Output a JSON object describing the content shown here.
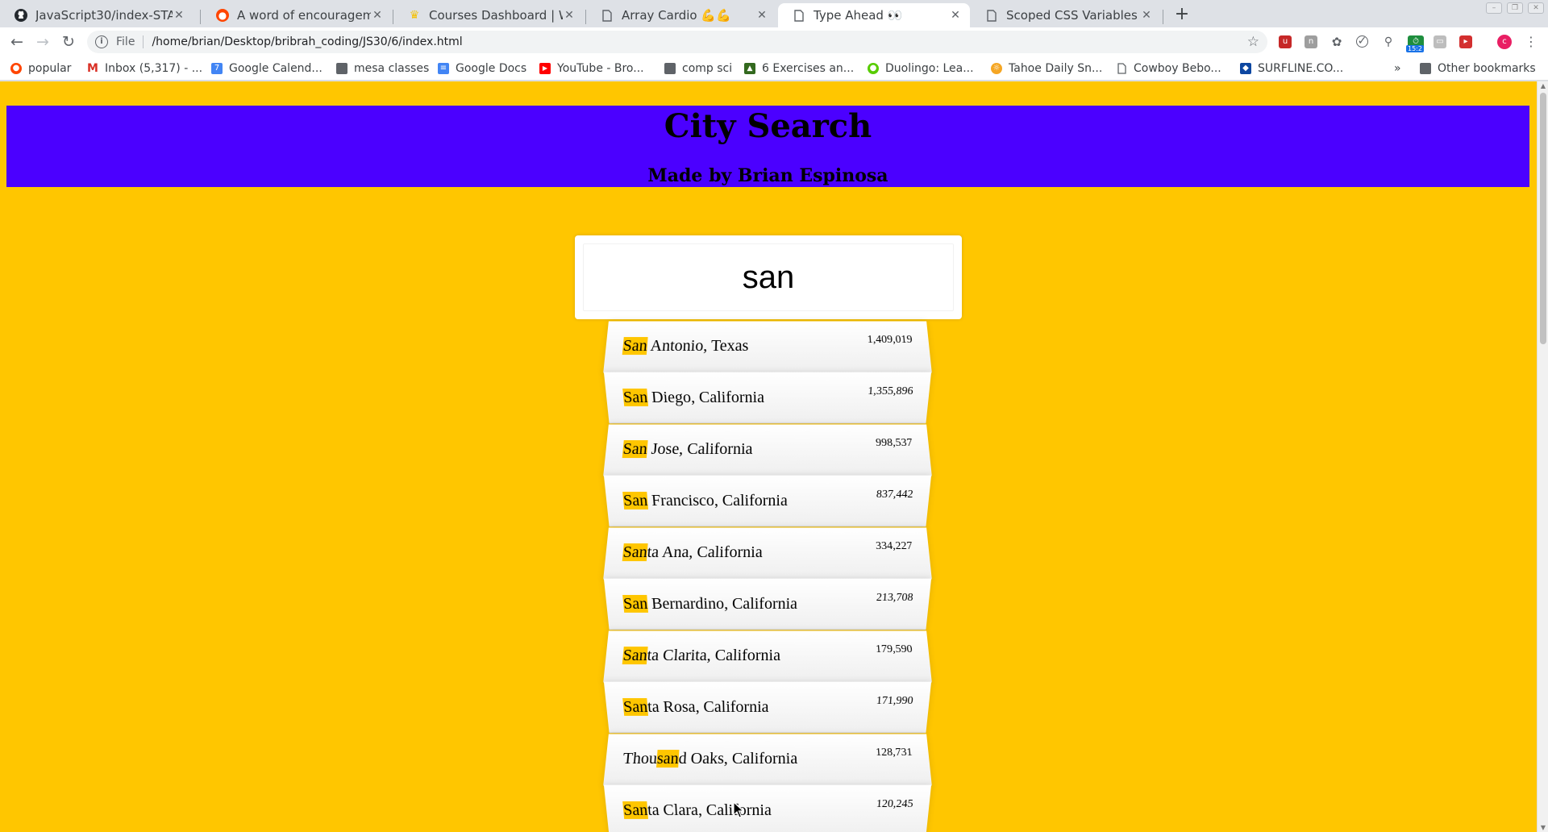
{
  "browser": {
    "tabs": [
      {
        "title": "JavaScript30/index-START",
        "icon": "github-icon"
      },
      {
        "title": "A word of encouragemen",
        "icon": "reddit-icon"
      },
      {
        "title": "Courses Dashboard | Wes",
        "icon": "crown-icon"
      },
      {
        "title": "Array Cardio 💪💪",
        "icon": "page-icon"
      },
      {
        "title": "Type Ahead 👀",
        "icon": "page-icon"
      },
      {
        "title": "Scoped CSS Variables and",
        "icon": "page-icon"
      }
    ],
    "active_tab_index": 4,
    "scheme_label": "File",
    "url": "/home/brian/Desktop/bribrah_coding/JS30/6/index.html",
    "bookmarks": [
      {
        "label": "popular",
        "icon": "reddit-icon"
      },
      {
        "label": "Inbox (5,317) - ...",
        "icon": "gmail-icon"
      },
      {
        "label": "Google Calend...",
        "icon": "calendar-icon"
      },
      {
        "label": "mesa classes",
        "icon": "folder-icon"
      },
      {
        "label": "Google Docs",
        "icon": "docs-icon"
      },
      {
        "label": "YouTube - Bro...",
        "icon": "youtube-icon"
      },
      {
        "label": "comp sci",
        "icon": "folder-icon"
      },
      {
        "label": "6 Exercises an...",
        "icon": "chart-icon"
      },
      {
        "label": "Duolingo: Lea...",
        "icon": "duolingo-icon"
      },
      {
        "label": "Tahoe Daily Sn...",
        "icon": "tahoe-icon"
      },
      {
        "label": "Cowboy Bebo...",
        "icon": "page-icon"
      },
      {
        "label": "SURFLINE.CO...",
        "icon": "surfline-icon"
      }
    ],
    "overflow_label": "»",
    "other_bookmarks_label": "Other bookmarks",
    "extension_badge": "15:2",
    "profile_initial": "c"
  },
  "page": {
    "title": "City Search",
    "subtitle": "Made by Brian Espinosa",
    "search_value": "san",
    "accent_color": "#ffc600",
    "banner_color": "#4b00ff",
    "results": [
      {
        "pre": "",
        "match": "San",
        "post": " Antonio, Texas",
        "population": "1,409,019"
      },
      {
        "pre": "",
        "match": "San",
        "post": " Diego, California",
        "population": "1,355,896"
      },
      {
        "pre": "",
        "match": "San",
        "post": " Jose, California",
        "population": "998,537"
      },
      {
        "pre": "",
        "match": "San",
        "post": " Francisco, California",
        "population": "837,442"
      },
      {
        "pre": "",
        "match": "San",
        "post": "ta Ana, California",
        "population": "334,227"
      },
      {
        "pre": "",
        "match": "San",
        "post": " Bernardino, California",
        "population": "213,708"
      },
      {
        "pre": "",
        "match": "San",
        "post": "ta Clarita, California",
        "population": "179,590"
      },
      {
        "pre": "",
        "match": "San",
        "post": "ta Rosa, California",
        "population": "171,990"
      },
      {
        "pre": "Thou",
        "match": "san",
        "post": "d Oaks, California",
        "population": "128,731"
      },
      {
        "pre": "",
        "match": "San",
        "post": "ta Clara, California",
        "population": "120,245"
      }
    ]
  }
}
